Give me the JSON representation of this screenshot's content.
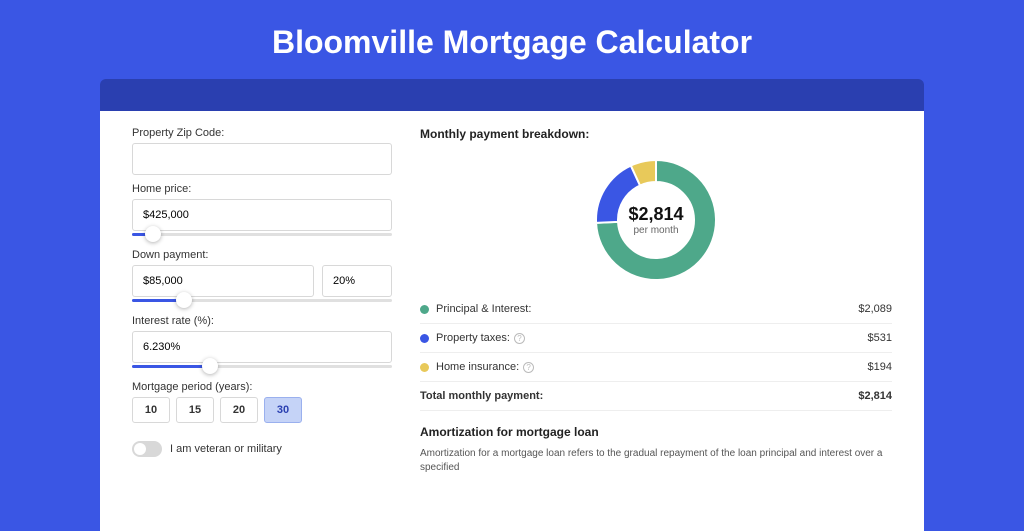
{
  "title": "Bloomville Mortgage Calculator",
  "form": {
    "zip_label": "Property Zip Code:",
    "zip_value": "",
    "home_price_label": "Home price:",
    "home_price_value": "$425,000",
    "home_price_slider_pct": 8,
    "down_payment_label": "Down payment:",
    "down_payment_value": "$85,000",
    "down_payment_pct": "20%",
    "down_payment_slider_pct": 20,
    "interest_label": "Interest rate (%):",
    "interest_value": "6.230%",
    "interest_slider_pct": 30,
    "period_label": "Mortgage period (years):",
    "period_options": [
      "10",
      "15",
      "20",
      "30"
    ],
    "period_selected": "30",
    "veteran_label": "I am veteran or military"
  },
  "breakdown": {
    "heading": "Monthly payment breakdown:",
    "donut_amount": "$2,814",
    "donut_sub": "per month",
    "rows": [
      {
        "label": "Principal & Interest:",
        "value": "$2,089",
        "color": "#4ea88a",
        "help": false
      },
      {
        "label": "Property taxes:",
        "value": "$531",
        "color": "#3a56e4",
        "help": true
      },
      {
        "label": "Home insurance:",
        "value": "$194",
        "color": "#e8c95a",
        "help": true
      }
    ],
    "total_label": "Total monthly payment:",
    "total_value": "$2,814"
  },
  "amortization": {
    "heading": "Amortization for mortgage loan",
    "text": "Amortization for a mortgage loan refers to the gradual repayment of the loan principal and interest over a specified"
  },
  "chart_data": {
    "type": "pie",
    "title": "Monthly payment breakdown",
    "series": [
      {
        "name": "Principal & Interest",
        "value": 2089,
        "color": "#4ea88a"
      },
      {
        "name": "Property taxes",
        "value": 531,
        "color": "#3a56e4"
      },
      {
        "name": "Home insurance",
        "value": 194,
        "color": "#e8c95a"
      }
    ],
    "total": 2814
  }
}
